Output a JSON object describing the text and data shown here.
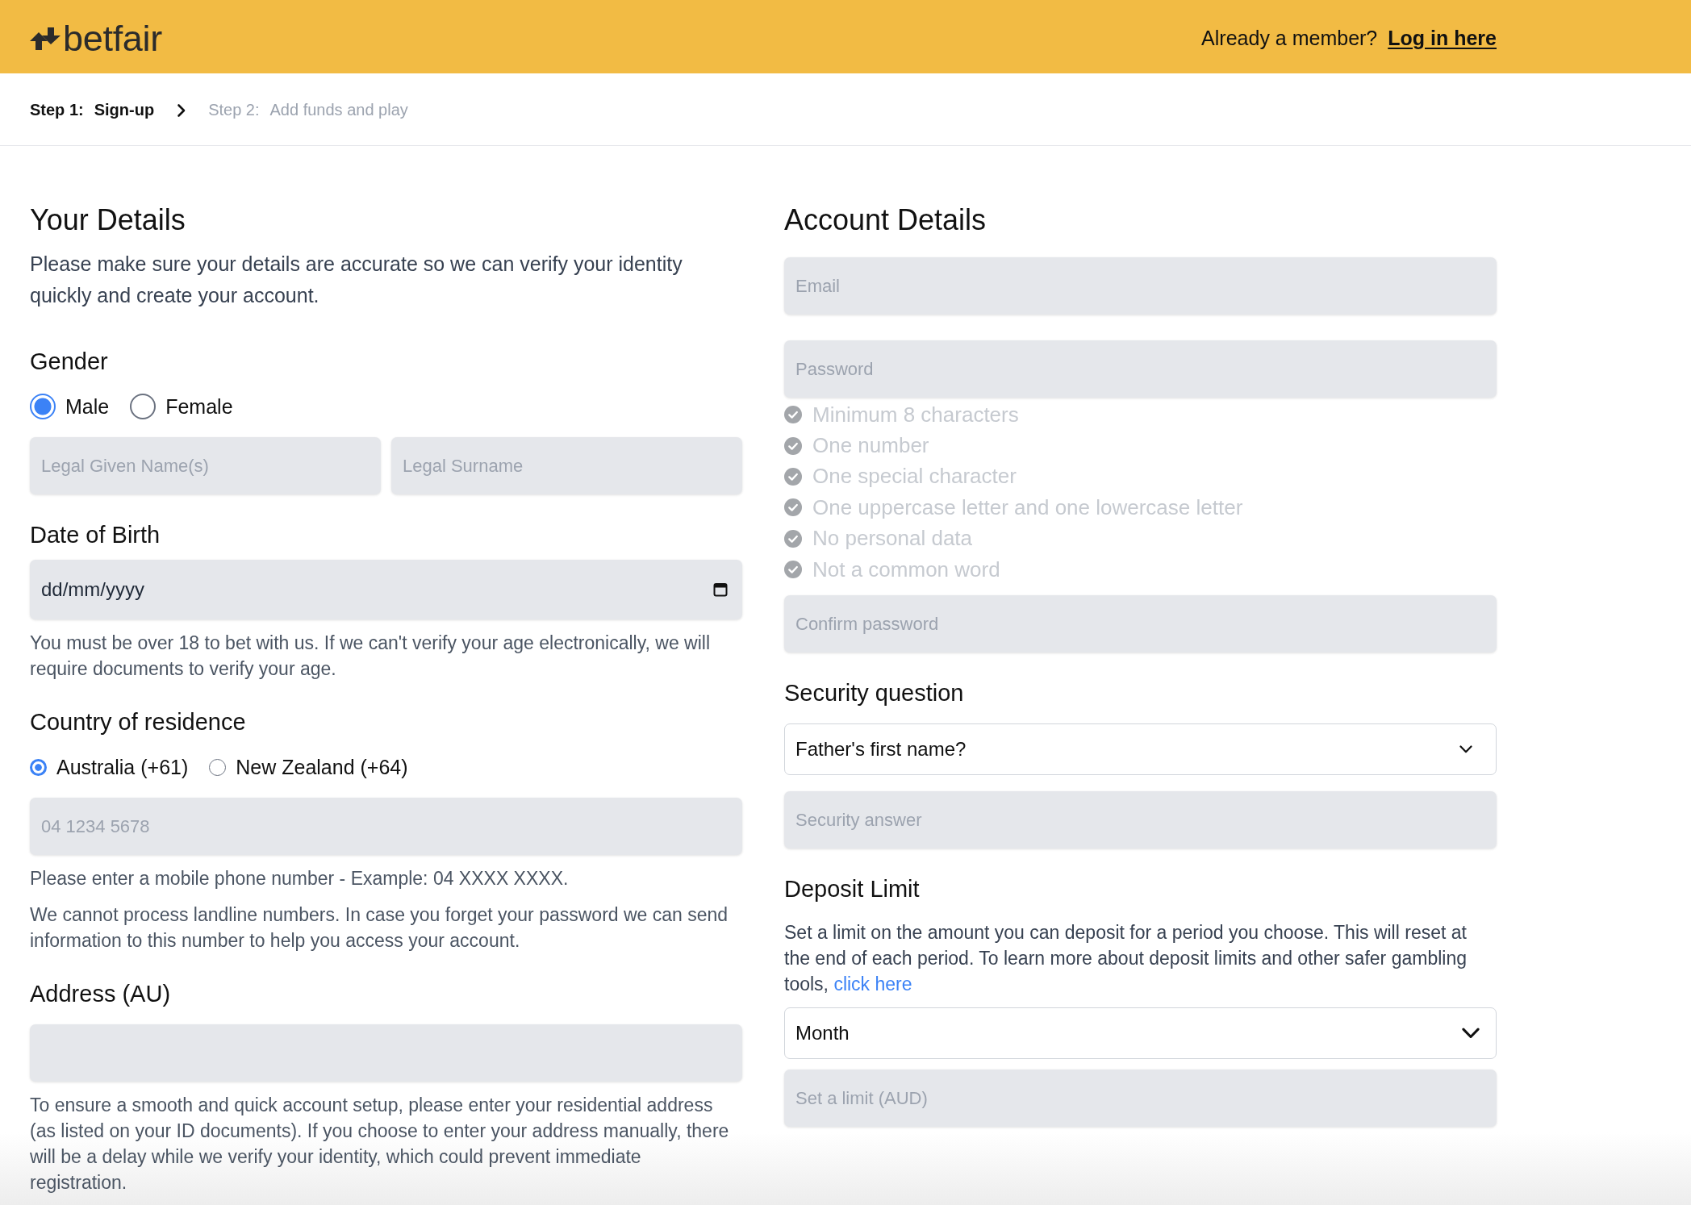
{
  "header": {
    "logo": "betfair",
    "member_prompt": "Already a member?",
    "login_link": "Log in here"
  },
  "steps": [
    {
      "number": "Step 1:",
      "label": "Sign-up",
      "selected": true
    },
    {
      "number": "Step 2:",
      "label": "Add funds and play",
      "selected": false
    }
  ],
  "your_details": {
    "title": "Your Details",
    "intro": "Please make sure your details are accurate so we can verify your identity quickly and create your account.",
    "gender": {
      "label": "Gender",
      "options": [
        {
          "label": "Male",
          "selected": true
        },
        {
          "label": "Female",
          "selected": false
        }
      ]
    },
    "name_fields": [
      {
        "placeholder": "Legal Given Name(s)"
      },
      {
        "placeholder": "Legal Surname"
      }
    ],
    "date_of_birth": {
      "label": "Date of Birth",
      "placeholder": "dd/mm/yyyy",
      "note": "You must be over 18 to bet with us. If we can't verify your age electronically, we will require documents to verify your age."
    },
    "country": {
      "label": "Country of residence",
      "options": [
        {
          "label": "Australia (+61)",
          "selected": true
        },
        {
          "label": "New Zealand (+64)",
          "selected": false
        }
      ],
      "phone": {
        "placeholder": "04 1234 5678"
      },
      "notes": [
        "Please enter a mobile phone number - Example: 04 XXXX XXXX.",
        "We cannot process landline numbers. In case you forget your password we can send information to this number to help you access your account."
      ]
    },
    "address": {
      "label": "Address (AU)",
      "note": "To ensure a smooth and quick account setup, please enter your residential address (as listed on your ID documents). If you choose to enter your address manually, there will be a delay while we verify your identity, which could prevent immediate registration."
    }
  },
  "account_details": {
    "title": "Account Details",
    "email": {
      "placeholder": "Email"
    },
    "password": {
      "placeholder": "Password"
    },
    "password_rules": [
      {
        "text": "Minimum 8 characters",
        "met": false
      },
      {
        "text": "One number",
        "met": false
      },
      {
        "text": "One special character",
        "met": false
      },
      {
        "text": "One uppercase letter and one lowercase letter",
        "met": false
      },
      {
        "text": "No personal data",
        "met": false
      },
      {
        "text": "Not a common word",
        "met": false
      }
    ],
    "confirm_password": {
      "placeholder": "Confirm password"
    },
    "security_question": {
      "label": "Security question",
      "value": "Father's first name?"
    },
    "security_answer": {
      "placeholder": "Security answer"
    },
    "deposit_limit": {
      "label": "Deposit Limit",
      "text": "Set a limit on the amount you can deposit for a period you choose. This will reset at the end of each period. To learn more about deposit limits and other safer gambling tools,",
      "link": "click here",
      "period": "Month",
      "amount": {
        "placeholder": "Set a limit (AUD)"
      }
    }
  }
}
